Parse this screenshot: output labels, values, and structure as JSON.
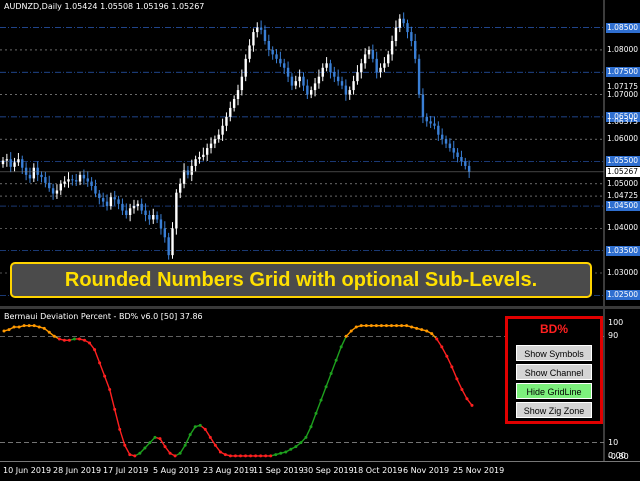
{
  "main_title": "AUDNZD,Daily  1.05424 1.05508 1.05196 1.05267",
  "sub_title": "Bermaui Deviation Percent - BD% v6.0 [50] 37.86",
  "banner_text": "Rounded Numbers Grid with optional Sub-Levels.",
  "price_axis": {
    "plain": [
      {
        "label": "1.08000",
        "v": 1.08
      },
      {
        "label": "1.07000",
        "v": 1.07
      },
      {
        "label": "1.06000",
        "v": 1.06
      },
      {
        "label": "1.05000",
        "v": 1.05
      },
      {
        "label": "1.04725",
        "v": 1.04725
      },
      {
        "label": "1.04000",
        "v": 1.04
      },
      {
        "label": "1.03000",
        "v": 1.03
      }
    ],
    "blue": [
      {
        "label": "1.08500",
        "v": 1.085
      },
      {
        "label": "1.07500",
        "v": 1.075
      },
      {
        "label": "1.06500",
        "v": 1.065
      },
      {
        "label": "1.05500",
        "v": 1.055
      },
      {
        "label": "1.04500",
        "v": 1.045
      },
      {
        "label": "1.03500",
        "v": 1.035
      },
      {
        "label": "1.02500",
        "v": 1.025
      }
    ],
    "minor": [
      {
        "label": "1.07175",
        "v": 1.07175
      },
      {
        "label": "1.06375",
        "v": 1.06375
      }
    ],
    "current": {
      "label": "1.05267",
      "v": 1.05267
    }
  },
  "indicator_axis": [
    {
      "label": "100",
      "v": 100
    },
    {
      "label": "90",
      "v": 90
    },
    {
      "label": "10",
      "v": 10
    },
    {
      "label": "0.00",
      "v": 0
    },
    {
      "label": "-0.80",
      "v": -0.8
    }
  ],
  "dates": [
    "10 Jun 2019",
    "28 Jun 2019",
    "17 Jul 2019",
    "5 Aug 2019",
    "23 Aug 2019",
    "11 Sep 2019",
    "30 Sep 2019",
    "18 Oct 2019",
    "6 Nov 2019",
    "25 Nov 2019"
  ],
  "panel": {
    "title": "BD%",
    "buttons": [
      "Show Symbols",
      "Show Channel",
      "Hide GridLine",
      "Show Zig Zone"
    ]
  },
  "colors": {
    "up_candle": "#ffffff",
    "down_candle": "#3a7fd5",
    "grid_blue": "#2a5bb8",
    "grid_white": "#aaaaaa",
    "bd_high": "#ff9900",
    "bd_falling": "#ff2020",
    "bd_rising": "#1ea01e",
    "banner_text": "#ffe000",
    "panel_border": "#e00000"
  },
  "chart_data": {
    "type": "candlestick",
    "title": "AUDNZD,Daily",
    "ylim": [
      1.0235,
      1.0885
    ],
    "closes": [
      1.0552,
      1.0555,
      1.0538,
      1.0548,
      1.0555,
      1.0536,
      1.052,
      1.0512,
      1.0536,
      1.052,
      1.0515,
      1.0502,
      1.049,
      1.0478,
      1.0485,
      1.05,
      1.0505,
      1.051,
      1.0508,
      1.0505,
      1.052,
      1.0512,
      1.0505,
      1.0495,
      1.0478,
      1.0468,
      1.046,
      1.045,
      1.047,
      1.0465,
      1.0455,
      1.044,
      1.043,
      1.0445,
      1.045,
      1.0455,
      1.044,
      1.043,
      1.042,
      1.043,
      1.042,
      1.04,
      1.038,
      1.034,
      1.04,
      1.048,
      1.05,
      1.053,
      1.052,
      1.054,
      1.0555,
      1.056,
      1.0565,
      1.058,
      1.059,
      1.06,
      1.061,
      1.063,
      1.065,
      1.067,
      1.069,
      1.071,
      1.074,
      1.078,
      1.081,
      1.084,
      1.085,
      1.0845,
      1.082,
      1.08,
      1.079,
      1.078,
      1.077,
      1.076,
      1.074,
      1.072,
      1.073,
      1.074,
      1.072,
      1.07,
      1.071,
      1.0725,
      1.074,
      1.076,
      1.077,
      1.075,
      1.074,
      1.073,
      1.072,
      1.07,
      1.071,
      1.073,
      1.075,
      1.077,
      1.079,
      1.08,
      1.078,
      1.075,
      1.076,
      1.077,
      1.079,
      1.082,
      1.085,
      1.087,
      1.086,
      1.084,
      1.082,
      1.078,
      1.07,
      1.065,
      1.064,
      1.0635,
      1.063,
      1.061,
      1.06,
      1.059,
      1.058,
      1.057,
      1.056,
      1.055,
      1.054,
      1.0527
    ],
    "indicator": {
      "name": "BD%",
      "ylim": [
        -0.8,
        100
      ],
      "levels": [
        90,
        10
      ],
      "values": [
        94,
        95,
        97,
        97,
        98,
        98,
        98,
        97,
        96,
        93,
        90,
        88,
        87,
        87,
        88,
        88,
        87,
        85,
        80,
        70,
        60,
        50,
        35,
        20,
        8,
        1,
        0,
        2,
        6,
        10,
        14,
        13,
        7,
        2,
        0,
        2,
        8,
        16,
        22,
        23,
        20,
        14,
        8,
        3,
        1,
        0,
        0,
        0,
        0,
        0,
        0,
        0,
        0,
        0,
        1,
        2,
        3,
        5,
        7,
        10,
        14,
        22,
        32,
        42,
        52,
        62,
        72,
        82,
        90,
        94,
        97,
        98,
        98,
        98,
        98,
        98,
        98,
        98,
        98,
        98,
        98,
        97,
        96,
        95,
        94,
        92,
        88,
        82,
        75,
        67,
        58,
        50,
        43,
        38
      ]
    }
  }
}
